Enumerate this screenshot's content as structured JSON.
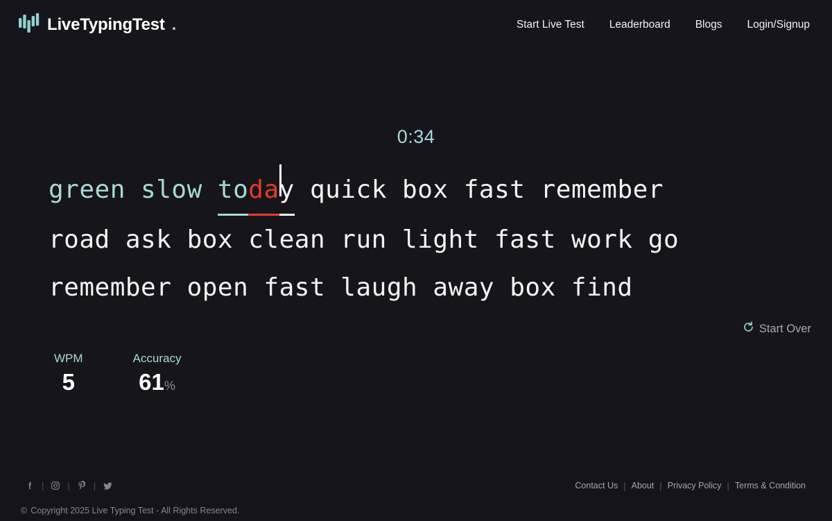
{
  "brand": {
    "name": "LiveTypingTest",
    "dot": ".",
    "logo_icon": "bar-chart-logo-icon",
    "accent_color": "#a5dad6"
  },
  "nav": {
    "items": [
      {
        "label": "Start Live Test"
      },
      {
        "label": "Leaderboard"
      },
      {
        "label": "Blogs"
      },
      {
        "label": "Login/Signup"
      }
    ]
  },
  "test": {
    "timer": "0:34",
    "lines": [
      {
        "prefix": "green slow ",
        "prefix_state": "correct",
        "active_word": {
          "correct": "to",
          "wrong": "da",
          "rest": "y"
        },
        "suffix": " quick box fast remember"
      },
      {
        "text": "road ask box clean run light fast work go"
      },
      {
        "text": "remember open fast laugh away box find"
      }
    ],
    "restart": {
      "label": "Start Over",
      "icon": "refresh-icon"
    },
    "colors": {
      "correct": "#a5dad6",
      "error": "#e8392a",
      "pending": "#f4f4f4",
      "caret": "#ffffff"
    }
  },
  "stats": [
    {
      "label": "WPM",
      "value": "5",
      "unit": ""
    },
    {
      "label": "Accuracy",
      "value": "61",
      "unit": "%"
    }
  ],
  "footer": {
    "socials": [
      {
        "name": "facebook-icon",
        "glyph": "f"
      },
      {
        "name": "instagram-icon",
        "glyph": ""
      },
      {
        "name": "pinterest-icon",
        "glyph": "P"
      },
      {
        "name": "twitter-icon",
        "glyph": ""
      }
    ],
    "separator": "|",
    "links": [
      {
        "label": "Contact Us"
      },
      {
        "label": "About"
      },
      {
        "label": "Privacy Policy"
      },
      {
        "label": "Terms & Condition"
      }
    ],
    "link_separator": "|",
    "copyright_mark": "©",
    "copyright": "Copyright 2025 Live Typing Test - All Rights Reserved."
  }
}
